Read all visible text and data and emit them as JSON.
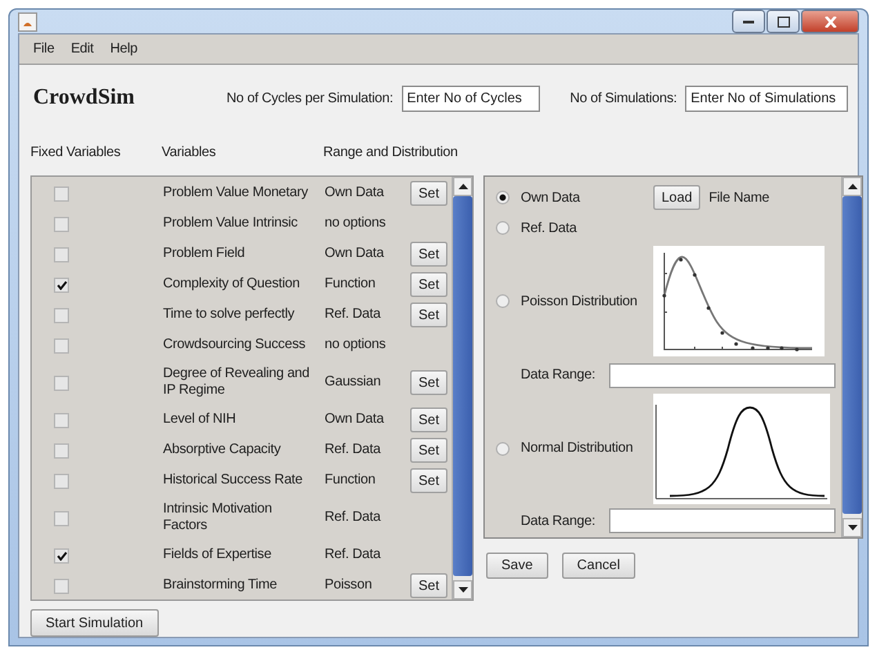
{
  "menu": [
    "File",
    "Edit",
    "Help"
  ],
  "app_title": "CrowdSim",
  "cycles": {
    "label": "No of Cycles per Simulation:",
    "placeholder": "Enter No of Cycles"
  },
  "simulations": {
    "label": "No of Simulations:",
    "placeholder": "Enter No of Simulations"
  },
  "columns": [
    "Fixed Variables",
    "Variables",
    "Range and Distribution"
  ],
  "rows": [
    {
      "fixed": false,
      "variable": "Problem Value Monetary",
      "distribution": "Own Data",
      "button": "Set"
    },
    {
      "fixed": false,
      "variable": "Problem Value Intrinsic",
      "distribution": "no options"
    },
    {
      "fixed": false,
      "variable": "Problem Field",
      "distribution": "Own Data",
      "button": "Set"
    },
    {
      "fixed": true,
      "variable": "Complexity of Question",
      "distribution": "Function",
      "button": "Set"
    },
    {
      "fixed": false,
      "variable": "Time to solve perfectly",
      "distribution": "Ref. Data",
      "button": "Set"
    },
    {
      "fixed": false,
      "variable": "Crowdsourcing Success",
      "distribution": "no options"
    },
    {
      "fixed": false,
      "variable": "Degree of Revealing and IP Regime",
      "distribution": "Gaussian",
      "button": "Set"
    },
    {
      "fixed": false,
      "variable": "Level of NIH",
      "distribution": "Own Data",
      "button": "Set"
    },
    {
      "fixed": false,
      "variable": "Absorptive Capacity",
      "distribution": "Ref. Data",
      "button": "Set"
    },
    {
      "fixed": false,
      "variable": "Historical Success Rate",
      "distribution": "Function",
      "button": "Set"
    },
    {
      "fixed": false,
      "variable": "Intrinsic Motivation Factors",
      "distribution": "Ref. Data"
    },
    {
      "fixed": true,
      "variable": "Fields of Expertise",
      "distribution": "Ref. Data"
    },
    {
      "fixed": false,
      "variable": "Brainstorming Time",
      "distribution": "Poisson",
      "button": "Set"
    }
  ],
  "options": [
    {
      "kind": "load",
      "label": "Own Data",
      "selected": true,
      "button": "Load",
      "file_label": "File Name"
    },
    {
      "kind": "plain",
      "label": "Ref. Data",
      "selected": false
    },
    {
      "kind": "poisson",
      "label": "Poisson Distribution",
      "selected": false,
      "range_label": "Data Range:"
    },
    {
      "kind": "normal",
      "label": "Normal Distribution",
      "selected": false,
      "range_label": "Data Range:"
    }
  ],
  "dialog_buttons": [
    "Save",
    "Cancel"
  ],
  "start_button": "Start Simulation"
}
